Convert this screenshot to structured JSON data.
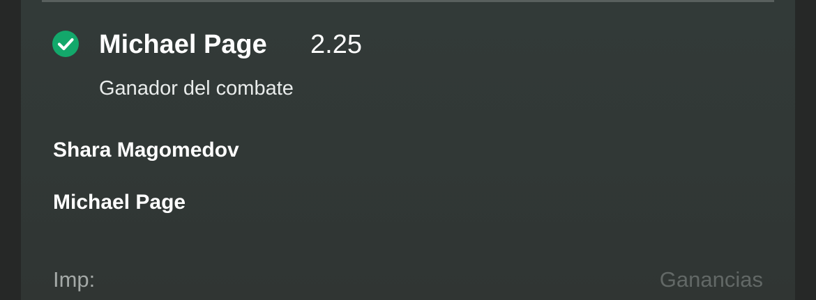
{
  "bet_slip": {
    "selection": {
      "name": "Michael Page",
      "odds": "2.25",
      "market": "Ganador del combate",
      "status_icon": "check-circle-icon",
      "status_color": "#13a86b"
    },
    "fighters": [
      {
        "name": "Shara Magomedov"
      },
      {
        "name": "Michael Page"
      }
    ],
    "stake": {
      "label": "Imp:",
      "winnings_label": "Ganancias"
    }
  }
}
